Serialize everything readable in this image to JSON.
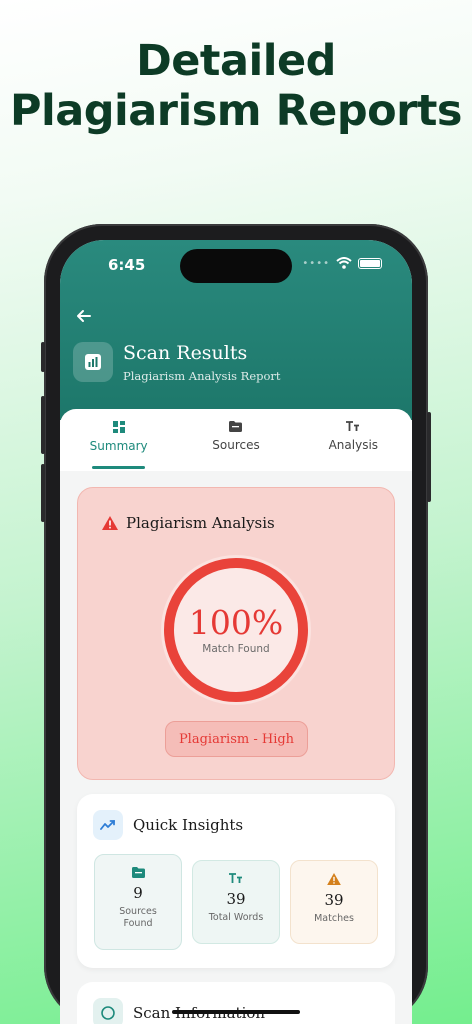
{
  "headline": {
    "line1": "Detailed",
    "line2": "Plagiarism Reports"
  },
  "status_bar": {
    "time": "6:45"
  },
  "header": {
    "title": "Scan Results",
    "subtitle": "Plagiarism Analysis Report"
  },
  "tabs": [
    {
      "label": "Summary",
      "icon": "grid-icon",
      "active": true
    },
    {
      "label": "Sources",
      "icon": "folder-icon",
      "active": false
    },
    {
      "label": "Analysis",
      "icon": "text-size-icon",
      "active": false
    }
  ],
  "analysis": {
    "title": "Plagiarism Analysis",
    "match_value": "100%",
    "match_label": "Match Found",
    "level": "Plagiarism - High"
  },
  "insights": {
    "title": "Quick Insights",
    "stats": [
      {
        "value": "9",
        "label": "Sources Found",
        "icon": "folder-icon"
      },
      {
        "value": "39",
        "label": "Total Words",
        "icon": "text-size-icon"
      },
      {
        "value": "39",
        "label": "Matches",
        "icon": "warning-icon"
      }
    ]
  },
  "scan_info": {
    "title": "Scan Information"
  },
  "colors": {
    "header": "#1d776a",
    "accent": "#1e8a7c",
    "danger": "#e53935",
    "headline": "#0d3b26"
  }
}
